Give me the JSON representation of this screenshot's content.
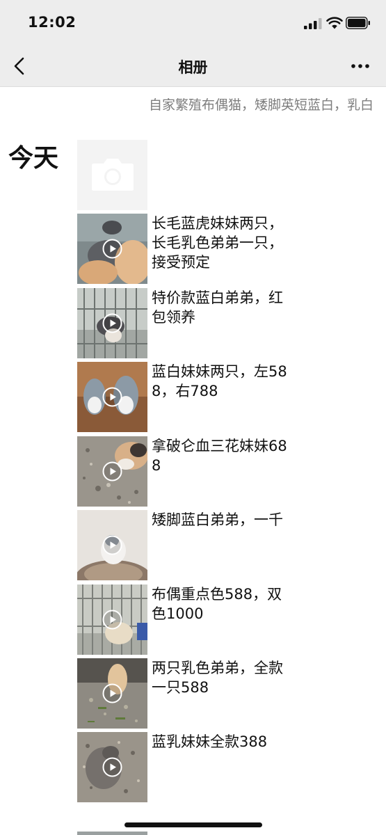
{
  "status_bar": {
    "time": "12:02"
  },
  "nav": {
    "title": "相册"
  },
  "profile": {
    "signature": "自家繁殖布偶猫，矮脚英短蓝白，乳白"
  },
  "sections": [
    {
      "day_label": "今天",
      "posts": [
        {
          "caption": "长毛蓝虎妹妹两只，长毛乳色弟弟一只，接受预定",
          "type": "video"
        },
        {
          "caption": "特价款蓝白弟弟，红包领养",
          "type": "video"
        },
        {
          "caption": "蓝白妹妹两只，左588，右788",
          "type": "video"
        },
        {
          "caption": "拿破仑血三花妹妹688",
          "type": "video"
        },
        {
          "caption": "矮脚蓝白弟弟，一千",
          "type": "video"
        },
        {
          "caption": "布偶重点色588，双色1000",
          "type": "video"
        },
        {
          "caption": "两只乳色弟弟，全款一只588",
          "type": "video"
        },
        {
          "caption": "蓝乳妹妹全款388",
          "type": "video"
        }
      ]
    }
  ],
  "icons": {
    "back": "chevron-left-icon",
    "more": "more-dots-icon",
    "camera": "camera-icon",
    "play": "play-icon"
  },
  "colors": {
    "nav_background": "#ededed",
    "signature_text": "#7d7d7d"
  }
}
